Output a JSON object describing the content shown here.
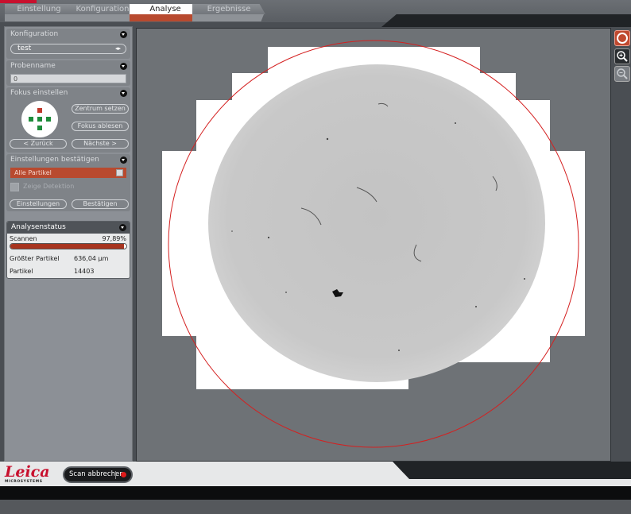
{
  "tabs": [
    {
      "label": "Einstellung",
      "active": false
    },
    {
      "label": "Konfiguration",
      "active": false
    },
    {
      "label": "Analyse",
      "active": true
    },
    {
      "label": "Ergebnisse",
      "active": false
    }
  ],
  "panel": {
    "konfiguration": {
      "title": "Konfiguration",
      "selected": "test"
    },
    "probenname": {
      "title": "Probenname",
      "value": "0"
    },
    "fokus": {
      "title": "Fokus einstellen",
      "center_btn": "Zentrum setzen",
      "read_btn": "Fokus ablesen",
      "back_btn": "< Zurück",
      "next_btn": "Nächste >"
    },
    "confirm": {
      "title": "Einstellungen bestätigen",
      "filter": "Alle Partikel",
      "show_detection": "Zeige Detektion",
      "settings_btn": "Einstellungen",
      "confirm_btn": "Bestätigen"
    },
    "status": {
      "title": "Analysenstatus",
      "scan_label": "Scannen",
      "scan_pct_text": "97,89%",
      "scan_progress": 0.9789,
      "largest_label": "Größter Partikel",
      "largest_value": "636,04 µm",
      "count_label": "Partikel",
      "count_value": "14403"
    }
  },
  "footer": {
    "brand": "Leica",
    "brand_sub": "MICROSYSTEMS",
    "abort_btn": "Scan abbrechen"
  },
  "colors": {
    "accent_red": "#b84a2f",
    "brand_red": "#c8102e",
    "circle_red": "#d42020"
  },
  "icons": [
    "circle-select-icon",
    "zoom-in-icon",
    "zoom-out-icon",
    "record-icon",
    "chevron-down-icon"
  ]
}
